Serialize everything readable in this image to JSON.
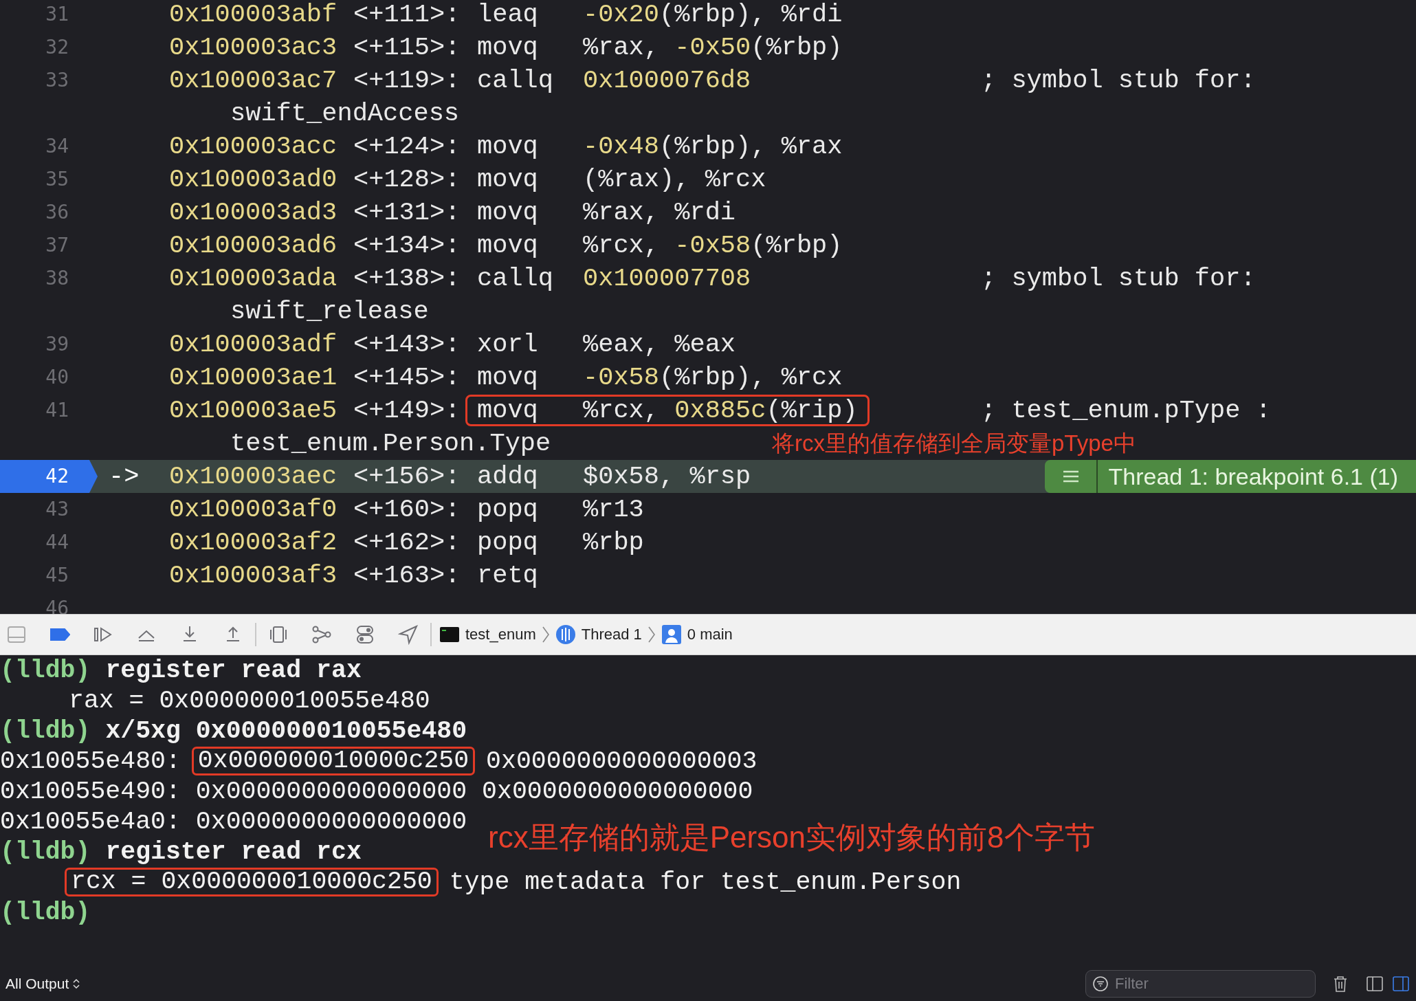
{
  "code_lines": [
    {
      "number": "31",
      "address": "0x100003abf",
      "offset": "<+111>:",
      "mnemonic": "leaq",
      "operands": [
        {
          "kind": "number",
          "text": "-0x20"
        },
        {
          "kind": "plain",
          "text": "(%rbp), %rdi"
        }
      ]
    },
    {
      "number": "32",
      "address": "0x100003ac3",
      "offset": "<+115>:",
      "mnemonic": "movq",
      "operands": [
        {
          "kind": "plain",
          "text": "%rax, "
        },
        {
          "kind": "number",
          "text": "-0x50"
        },
        {
          "kind": "plain",
          "text": "(%rbp)"
        }
      ]
    },
    {
      "number": "33",
      "address": "0x100003ac7",
      "offset": "<+119>:",
      "mnemonic": "callq",
      "operands": [
        {
          "kind": "number",
          "text": "0x1000076d8"
        }
      ],
      "comment": "; symbol stub for:",
      "continuation": "swift_endAccess"
    },
    {
      "number": "34",
      "address": "0x100003acc",
      "offset": "<+124>:",
      "mnemonic": "movq",
      "operands": [
        {
          "kind": "number",
          "text": "-0x48"
        },
        {
          "kind": "plain",
          "text": "(%rbp), %rax"
        }
      ]
    },
    {
      "number": "35",
      "address": "0x100003ad0",
      "offset": "<+128>:",
      "mnemonic": "movq",
      "operands": [
        {
          "kind": "plain",
          "text": "(%rax), %rcx"
        }
      ]
    },
    {
      "number": "36",
      "address": "0x100003ad3",
      "offset": "<+131>:",
      "mnemonic": "movq",
      "operands": [
        {
          "kind": "plain",
          "text": "%rax, %rdi"
        }
      ]
    },
    {
      "number": "37",
      "address": "0x100003ad6",
      "offset": "<+134>:",
      "mnemonic": "movq",
      "operands": [
        {
          "kind": "plain",
          "text": "%rcx, "
        },
        {
          "kind": "number",
          "text": "-0x58"
        },
        {
          "kind": "plain",
          "text": "(%rbp)"
        }
      ]
    },
    {
      "number": "38",
      "address": "0x100003ada",
      "offset": "<+138>:",
      "mnemonic": "callq",
      "operands": [
        {
          "kind": "number",
          "text": "0x100007708"
        }
      ],
      "comment": "; symbol stub for:",
      "continuation": "swift_release"
    },
    {
      "number": "39",
      "address": "0x100003adf",
      "offset": "<+143>:",
      "mnemonic": "xorl",
      "operands": [
        {
          "kind": "plain",
          "text": "%eax, %eax"
        }
      ]
    },
    {
      "number": "40",
      "address": "0x100003ae1",
      "offset": "<+145>:",
      "mnemonic": "movq",
      "operands": [
        {
          "kind": "number",
          "text": "-0x58"
        },
        {
          "kind": "plain",
          "text": "(%rbp), %rcx"
        }
      ]
    },
    {
      "number": "41",
      "address": "0x100003ae5",
      "offset": "<+149>:",
      "mnemonic": "movq",
      "operands": [
        {
          "kind": "plain",
          "text": "%rcx, "
        },
        {
          "kind": "number",
          "text": "0x885c"
        },
        {
          "kind": "plain",
          "text": "(%rip)"
        }
      ],
      "boxed": true,
      "comment": "; test_enum.pType :",
      "continuation": "test_enum.Person.Type",
      "annotation": "将rcx里的值存储到全局变量pType中"
    },
    {
      "number": "42",
      "address": "0x100003aec",
      "offset": "<+156>:",
      "mnemonic": "addq",
      "operands": [
        {
          "kind": "plain",
          "text": "$0x58, %rsp"
        }
      ],
      "current": true,
      "pointer": "->",
      "breakpoint": "Thread 1: breakpoint 6.1 (1)"
    },
    {
      "number": "43",
      "address": "0x100003af0",
      "offset": "<+160>:",
      "mnemonic": "popq",
      "operands": [
        {
          "kind": "plain",
          "text": "%r13"
        }
      ]
    },
    {
      "number": "44",
      "address": "0x100003af2",
      "offset": "<+162>:",
      "mnemonic": "popq",
      "operands": [
        {
          "kind": "plain",
          "text": "%rbp"
        }
      ]
    },
    {
      "number": "45",
      "address": "0x100003af3",
      "offset": "<+163>:",
      "mnemonic": "retq"
    },
    {
      "number": "46"
    }
  ],
  "debug_bar": {
    "breakpoints_active": true,
    "breadcrumbs": [
      {
        "label": "test_enum"
      },
      {
        "label": "Thread 1"
      },
      {
        "label": "0 main"
      }
    ]
  },
  "console": {
    "lines": [
      {
        "segments": [
          {
            "kind": "prompt",
            "text": "(lldb)"
          },
          {
            "kind": "command",
            "text": "register read rax"
          }
        ]
      },
      {
        "indent": true,
        "segments": [
          {
            "kind": "output",
            "text": "rax = 0x000000010055e480"
          }
        ]
      },
      {
        "segments": [
          {
            "kind": "prompt",
            "text": "(lldb)"
          },
          {
            "kind": "command",
            "text": "x/5xg 0x000000010055e480"
          }
        ]
      },
      {
        "segments": [
          {
            "kind": "output",
            "text": "0x10055e480:"
          },
          {
            "kind": "boxed",
            "text": "0x000000010000c250"
          },
          {
            "kind": "output",
            "text": "0x0000000000000003"
          }
        ]
      },
      {
        "segments": [
          {
            "kind": "output",
            "text": "0x10055e490:"
          },
          {
            "kind": "output",
            "text": "0x0000000000000000"
          },
          {
            "kind": "output",
            "text": "0x0000000000000000"
          }
        ]
      },
      {
        "segments": [
          {
            "kind": "output",
            "text": "0x10055e4a0:"
          },
          {
            "kind": "output",
            "text": "0x0000000000000000"
          }
        ]
      },
      {
        "segments": [
          {
            "kind": "prompt",
            "text": "(lldb)"
          },
          {
            "kind": "command",
            "text": "register read rcx"
          }
        ]
      },
      {
        "indent": true,
        "segments": [
          {
            "kind": "boxed",
            "text": "rcx = 0x000000010000c250"
          },
          {
            "kind": "output",
            "text": "type metadata for test_enum.Person"
          }
        ]
      },
      {
        "segments": [
          {
            "kind": "prompt",
            "text": "(lldb)"
          }
        ]
      }
    ],
    "annotation": "rcx里存储的就是Person实例对象的前8个字节"
  },
  "bottom_bar": {
    "output_selector": "All Output",
    "filter_placeholder": "Filter"
  }
}
